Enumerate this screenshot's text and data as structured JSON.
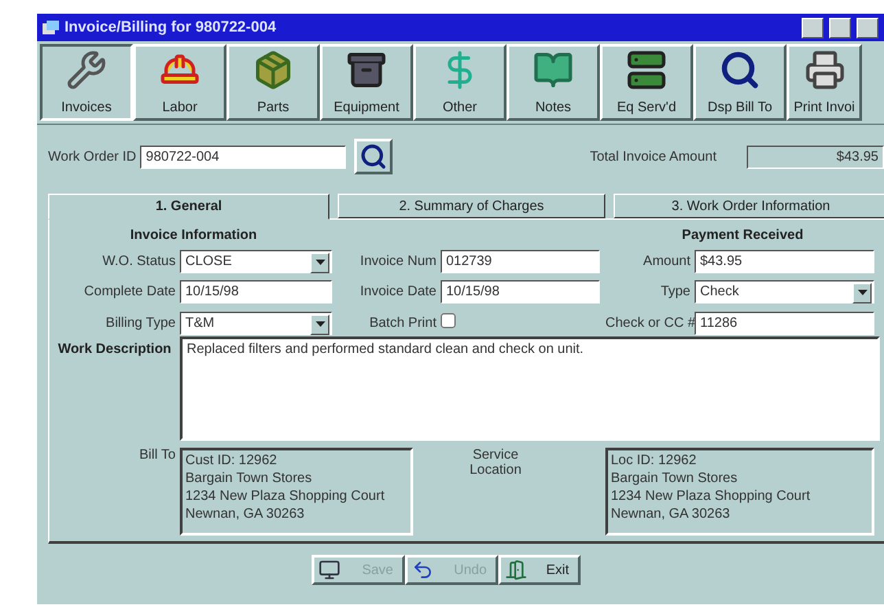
{
  "window": {
    "title": "Invoice/Billing for 980722-004"
  },
  "toolbar": [
    {
      "label": "Invoices",
      "selected": true
    },
    {
      "label": "Labor",
      "selected": false
    },
    {
      "label": "Parts",
      "selected": false
    },
    {
      "label": "Equipment",
      "selected": false
    },
    {
      "label": "Other",
      "selected": false
    },
    {
      "label": "Notes",
      "selected": false
    },
    {
      "label": "Eq Serv'd",
      "selected": false
    },
    {
      "label": "Dsp Bill To",
      "selected": false
    },
    {
      "label": "Print Invoi",
      "selected": false
    }
  ],
  "work_order": {
    "label": "Work Order ID",
    "value": "980722-004"
  },
  "total": {
    "label": "Total Invoice Amount",
    "value": "$43.95"
  },
  "tabs": [
    {
      "label": "1. General",
      "selected": true
    },
    {
      "label": "2. Summary of Charges",
      "selected": false
    },
    {
      "label": "3. Work Order Information",
      "selected": false
    }
  ],
  "invoice_section": {
    "title": "Invoice Information"
  },
  "payment_section": {
    "title": "Payment Received"
  },
  "fields": [
    {
      "label": "W.O. Status",
      "value": "CLOSE",
      "kind": "dropdown"
    },
    {
      "label": "Invoice Num",
      "value": "012739",
      "kind": "text"
    },
    {
      "label": "Amount",
      "value": "$43.95",
      "kind": "text"
    },
    {
      "label": "Complete Date",
      "value": "10/15/98",
      "kind": "text"
    },
    {
      "label": "Invoice Date",
      "value": "10/15/98",
      "kind": "text"
    },
    {
      "label": "Type",
      "value": "Check",
      "kind": "dropdown"
    },
    {
      "label": "Billing Type",
      "value": "T&M",
      "kind": "dropdown"
    },
    {
      "label": "Batch Print",
      "checked": false,
      "kind": "checkbox"
    },
    {
      "label": "Check or CC #",
      "value": "11286",
      "kind": "text"
    }
  ],
  "work_description": {
    "label": "Work Description",
    "value": "Replaced filters and performed standard clean and check on unit."
  },
  "bill_to": {
    "label": "Bill To",
    "lines": [
      "Cust ID: 12962",
      "Bargain Town Stores",
      "1234 New Plaza Shopping Court",
      "Newnan, GA 30263"
    ]
  },
  "service_location": {
    "label": "Service Location",
    "lines": [
      "Loc ID: 12962",
      "Bargain Town Stores",
      "1234 New Plaza Shopping Court",
      "Newnan, GA 30263"
    ]
  },
  "buttons": [
    {
      "label": "Save",
      "disabled": true
    },
    {
      "label": "Undo",
      "disabled": true
    },
    {
      "label": "Exit",
      "disabled": false
    }
  ]
}
